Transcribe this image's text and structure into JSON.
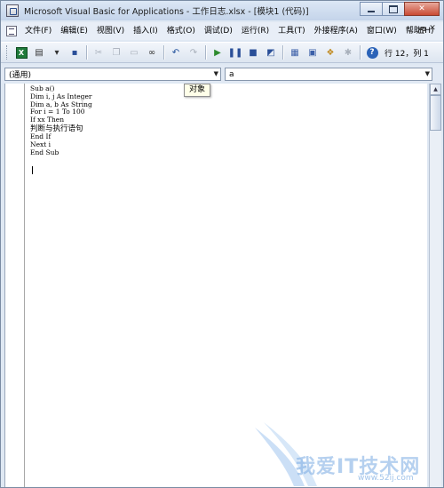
{
  "window": {
    "title": "Microsoft Visual Basic for Applications - 工作日志.xlsx - [模块1 (代码)]",
    "controls": {
      "minimize": "",
      "maximize": "",
      "close": "✕"
    }
  },
  "menubar": {
    "items": [
      {
        "label": "文件(F)"
      },
      {
        "label": "编辑(E)"
      },
      {
        "label": "视图(V)"
      },
      {
        "label": "插入(I)"
      },
      {
        "label": "格式(O)"
      },
      {
        "label": "调试(D)"
      },
      {
        "label": "运行(R)"
      },
      {
        "label": "工具(T)"
      },
      {
        "label": "外接程序(A)"
      },
      {
        "label": "窗口(W)"
      },
      {
        "label": "帮助(H)"
      }
    ],
    "mdi_controls": [
      "_",
      "🗗",
      "✕"
    ]
  },
  "toolbar": {
    "position_text": "行 12，列 1"
  },
  "combos": {
    "object": "(通用)",
    "procedure": "a"
  },
  "tooltip": {
    "text": "对象"
  },
  "code": {
    "lines": [
      "Sub a()",
      "Dim i, j As Integer",
      "Dim a, b As String",
      "For i = 1 To 100",
      "If xx Then",
      "判断与执行语句",
      "End If",
      "Next i",
      "End Sub"
    ]
  },
  "watermark": {
    "text": "我爱IT技术网",
    "url": "www.52ij.com"
  },
  "colors": {
    "titlebar": "#c4d4ea",
    "close_button": "#c94a34",
    "code_background": "#ffffff"
  }
}
